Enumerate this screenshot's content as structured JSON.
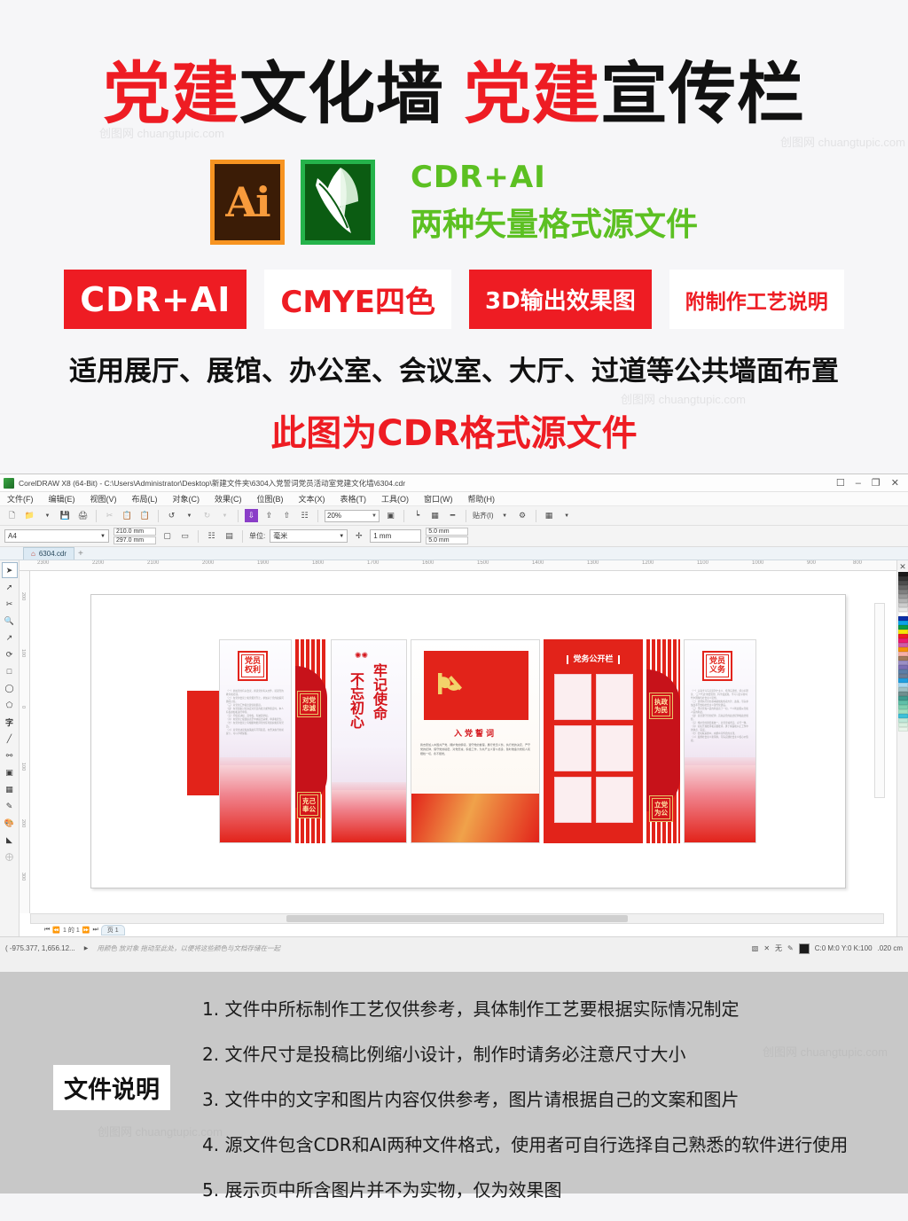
{
  "promo": {
    "title": {
      "seg1_red": "党建",
      "seg1_black": "文化墙",
      "seg2_red": "党建",
      "seg2_black": "宣传栏"
    },
    "logos": {
      "ai_label": "Ai",
      "ai_icon": "adobe-illustrator-icon",
      "cdr_icon": "coreldraw-icon",
      "text_line1": "CDR+AI",
      "text_line2": "两种矢量格式源文件",
      "green": "#5cc022"
    },
    "badges": [
      {
        "label": "CDR+AI",
        "style": "solid"
      },
      {
        "label": "CMYE四色",
        "style": "outline"
      },
      {
        "label": "3D输出效果图",
        "style": "solid2"
      },
      {
        "label": "附制作工艺说明",
        "style": "outline2"
      }
    ],
    "line1": "适用展厅、展馆、办公室、会议室、大厅、过道等公共墙面布置",
    "line2": "此图为CDR格式源文件",
    "accent_red": "#ee1c23",
    "watermark": "创图网 chuangtupic.com"
  },
  "coreldraw": {
    "titlebar": {
      "text": "CorelDRAW X8 (64-Bit) - C:\\Users\\Administrator\\Desktop\\新建文件夹\\6304入党誓词党员活动室党建文化墙\\6304.cdr",
      "controls": [
        "restore-down",
        "minimize",
        "maximize",
        "close"
      ]
    },
    "menu": [
      "文件(F)",
      "编辑(E)",
      "视图(V)",
      "布局(L)",
      "对象(C)",
      "效果(C)",
      "位图(B)",
      "文本(X)",
      "表格(T)",
      "工具(O)",
      "窗口(W)",
      "帮助(H)"
    ],
    "toolbar": {
      "icons": [
        "new-icon",
        "open-icon",
        "save-icon",
        "print-icon",
        "cut-icon",
        "copy-icon",
        "paste-icon",
        "undo-icon",
        "redo-icon",
        "import-icon",
        "export-icon",
        "publish-pdf-icon",
        "zoom-level",
        "fullscreen-icon",
        "show-rulers-icon",
        "grid-icon",
        "snap-icon",
        "options-icon",
        "launch-icon"
      ],
      "zoom_value": "20%",
      "snap_label": "贴齐(I)",
      "gear_icon": "gear-icon"
    },
    "propbar": {
      "page_preset": "A4",
      "width": "210.0 mm",
      "height": "297.0 mm",
      "unit_label": "单位:",
      "unit_value": "毫米",
      "nudge": "1 mm",
      "dup_x": "5.0 mm",
      "dup_y": "5.0 mm"
    },
    "doctab": {
      "name": "6304.cdr",
      "home_icon": "home-icon",
      "plus_icon": "add-tab-icon"
    },
    "toolbox": [
      "pick-tool",
      "shape-tool",
      "crop-tool",
      "zoom-tool",
      "freehand-tool",
      "artistic-media-tool",
      "rectangle-tool",
      "ellipse-tool",
      "polygon-tool",
      "text-tool",
      "parallel-dimension-tool",
      "connector-tool",
      "drop-shadow-tool",
      "transparency-tool",
      "color-eyedropper-tool",
      "interactive-fill-tool",
      "smart-fill-tool",
      "outline-tool"
    ],
    "hruler_ticks": [
      "2300",
      "2200",
      "2100",
      "2000",
      "1900",
      "1800",
      "1700",
      "1600",
      "1500",
      "1400",
      "1300",
      "1200",
      "1100",
      "1000",
      "900",
      "800"
    ],
    "vruler_ticks": [
      "200",
      "100",
      "0",
      "100",
      "200",
      "300"
    ],
    "statusbar": {
      "coords": "( -975.377, 1,656.12...",
      "hint": "用颜色 放对象 拖动至此处，以便将这些颜色与文档存储在一起",
      "fill_none": "无",
      "outline_color": "C:0 M:0 Y:0 K:100",
      "outline_width": ".020 cm",
      "page_of": "1 的 1",
      "page_tab": "页 1"
    },
    "artwork": {
      "panel1": {
        "seal": "党员\n权利",
        "seal_line1": "党员",
        "seal_line2": "权利"
      },
      "stripe1": {
        "seal_top_l1": "对党",
        "seal_top_l2": "忠诚",
        "seal_bottom_l1": "克己",
        "seal_bottom_l2": "奉公"
      },
      "panel2": {
        "col_right": "牢记使命",
        "col_left": "不忘初心"
      },
      "panel3": {
        "oath_title": "入党誓词",
        "oath_body": "我志愿加入中国共产党，拥护党的纲领，遵守党的章程，履行党员义务，执行党的决定，严守党的纪律，保守党的秘密，对党忠诚，积极工作，为共产主义奋斗终身，随时准备为党和人民牺牲一切，永不叛党。",
        "flag_icon": "party-flag-icon"
      },
      "panel4": {
        "board_title": "党务公开栏",
        "cells": 6
      },
      "stripe2": {
        "seal_top_l1": "执政",
        "seal_top_l2": "为民",
        "seal_bottom_l1": "立党",
        "seal_bottom_l2": "为公"
      },
      "panel5": {
        "seal_line1": "党员",
        "seal_line2": "义务"
      }
    },
    "palette_colors": [
      "#1a1a1a",
      "#333333",
      "#4d4d4d",
      "#666666",
      "#808080",
      "#999999",
      "#b3b3b3",
      "#cccccc",
      "#e6e6e6",
      "#ffffff",
      "#0b2ea8",
      "#0aa3e8",
      "#0b9b45",
      "#f5e609",
      "#ee1c23",
      "#ec1b70",
      "#d05aa8",
      "#f5920b",
      "#f7b0a8",
      "#a07a5c",
      "#9b8fc4",
      "#7b6fb3",
      "#5b7fa8",
      "#6a7d94",
      "#1f9fe0",
      "#a8d8f0",
      "#9fc0c4",
      "#6f8f8f",
      "#3f9b8f",
      "#5fbfa8",
      "#7fd0b0",
      "#9fe0c0",
      "#3fc0d8",
      "#bfe8d8",
      "#d8f0e0",
      "#e8f5ea"
    ]
  },
  "notes": {
    "label": "文件说明",
    "items": [
      "1. 文件中所标制作工艺仅供参考，具体制作工艺要根据实际情况制定",
      "2. 文件尺寸是投稿比例缩小设计，制作时请务必注意尺寸大小",
      "3. 文件中的文字和图片内容仅供参考，图片请根据自己的文案和图片",
      "4. 源文件包含CDR和AI两种文件格式，使用者可自行选择自己熟悉的软件进行使用",
      "5. 展示页中所含图片并不为实物，仅为效果图"
    ],
    "bg": "#c8c8c8"
  }
}
